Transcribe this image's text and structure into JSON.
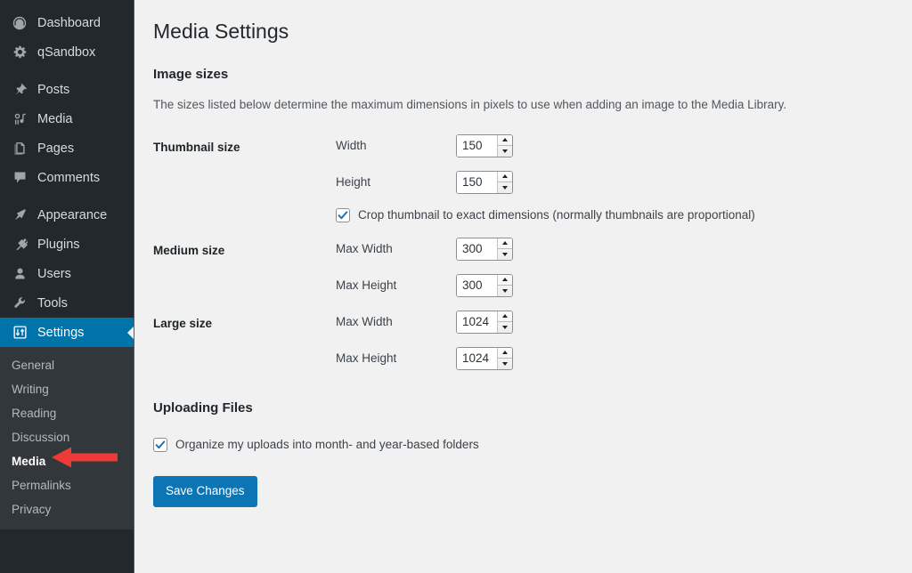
{
  "sidebar": {
    "top_items": [
      {
        "label": "Dashboard",
        "icon": "dashboard-icon"
      },
      {
        "label": "qSandbox",
        "icon": "gear-icon"
      }
    ],
    "content_items": [
      {
        "label": "Posts",
        "icon": "pin-icon"
      },
      {
        "label": "Media",
        "icon": "media-icon"
      },
      {
        "label": "Pages",
        "icon": "pages-icon"
      },
      {
        "label": "Comments",
        "icon": "comment-icon"
      }
    ],
    "admin_items": [
      {
        "label": "Appearance",
        "icon": "paintbrush-icon"
      },
      {
        "label": "Plugins",
        "icon": "plug-icon"
      },
      {
        "label": "Users",
        "icon": "user-icon"
      },
      {
        "label": "Tools",
        "icon": "wrench-icon"
      },
      {
        "label": "Settings",
        "icon": "settings-icon",
        "active": true
      }
    ],
    "submenu": [
      {
        "label": "General"
      },
      {
        "label": "Writing"
      },
      {
        "label": "Reading"
      },
      {
        "label": "Discussion"
      },
      {
        "label": "Media",
        "current": true
      },
      {
        "label": "Permalinks"
      },
      {
        "label": "Privacy"
      }
    ],
    "annotation": {
      "name": "red-arrow",
      "color": "#ec3b36",
      "points_to": "Media"
    }
  },
  "main": {
    "page_title": "Media Settings",
    "image_sizes": {
      "heading": "Image sizes",
      "description": "The sizes listed below determine the maximum dimensions in pixels to use when adding an image to the Media Library.",
      "rows": [
        {
          "title": "Thumbnail size",
          "fields": [
            {
              "label": "Width",
              "value": "150"
            },
            {
              "label": "Height",
              "value": "150"
            }
          ],
          "checkbox": {
            "label": "Crop thumbnail to exact dimensions (normally thumbnails are proportional)",
            "checked": true
          }
        },
        {
          "title": "Medium size",
          "fields": [
            {
              "label": "Max Width",
              "value": "300"
            },
            {
              "label": "Max Height",
              "value": "300"
            }
          ]
        },
        {
          "title": "Large size",
          "fields": [
            {
              "label": "Max Width",
              "value": "1024"
            },
            {
              "label": "Max Height",
              "value": "1024"
            }
          ]
        }
      ]
    },
    "uploading_files": {
      "heading": "Uploading Files",
      "checkbox": {
        "label": "Organize my uploads into month- and year-based folders",
        "checked": true
      }
    },
    "save_button": "Save Changes"
  },
  "colors": {
    "sidebar_bg": "#23282d",
    "submenu_bg": "#32373c",
    "accent_blue": "#0073aa",
    "button_blue": "#0d75b4",
    "content_bg": "#f1f1f1",
    "annotation_red": "#ec3b36"
  }
}
